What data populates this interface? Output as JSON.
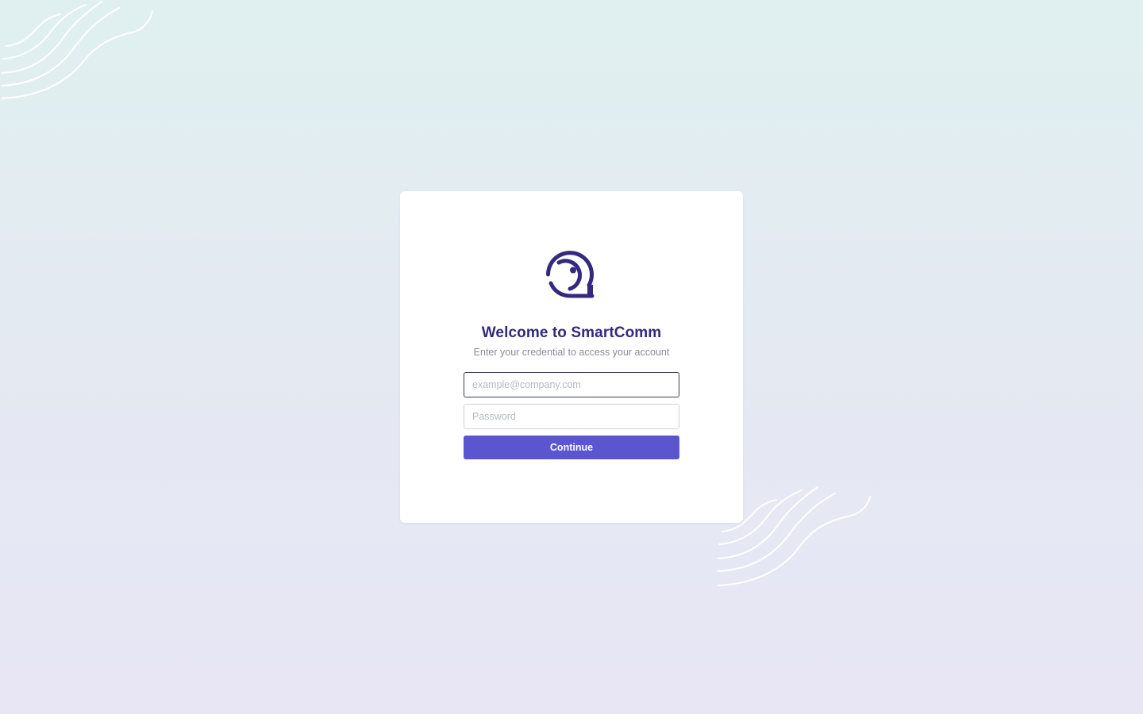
{
  "login": {
    "title": "Welcome to SmartComm",
    "subtitle": "Enter your credential to access your account",
    "email": {
      "placeholder": "example@company.com",
      "value": ""
    },
    "password": {
      "placeholder": "Password",
      "value": ""
    },
    "continue_label": "Continue"
  },
  "colors": {
    "brand": "#35297f",
    "button": "#5b55cf",
    "background_top": "#e0f0f0",
    "background_bottom": "#e8e6f5"
  },
  "icons": {
    "logo": "smartcomm-logo-icon",
    "decoration": "wave-lines-decoration"
  }
}
